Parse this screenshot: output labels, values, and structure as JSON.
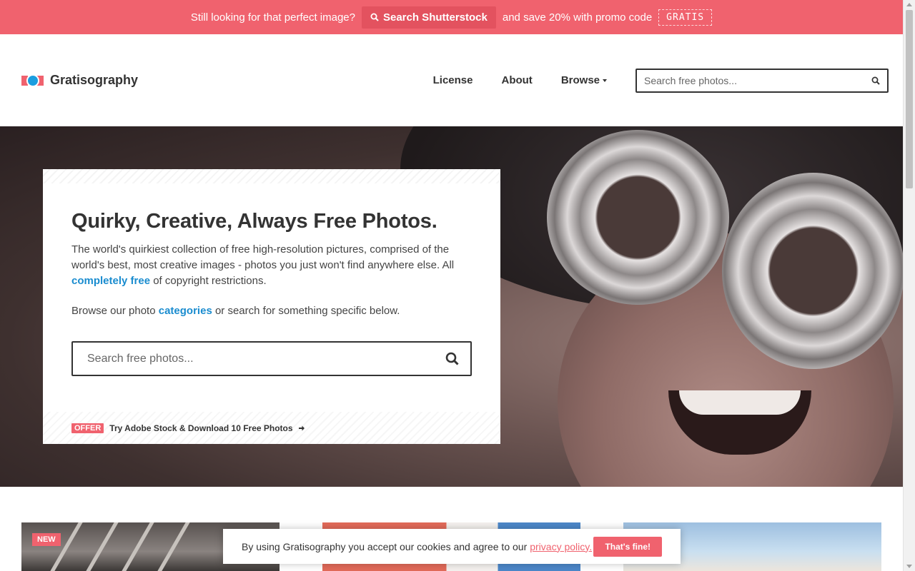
{
  "promo": {
    "lead": "Still looking for that perfect image?",
    "button": "Search Shutterstock",
    "tail": "and save 20% with promo code",
    "code": "GRATIS"
  },
  "header": {
    "logo": "Gratisography",
    "nav": [
      {
        "label": "License"
      },
      {
        "label": "About"
      },
      {
        "label": "Browse"
      }
    ],
    "search_placeholder": "Search free photos..."
  },
  "hero": {
    "title": "Quirky, Creative, Always Free Photos.",
    "description_before": "The world's quirkiest collection of free high-resolution pictures, comprised of the world's best, most creative images - photos you just won't find anywhere else. All ",
    "description_link": "completely free",
    "description_after": " of copyright restrictions.",
    "browse_before": "Browse our photo ",
    "browse_link": "categories",
    "browse_after": " or search for something specific below.",
    "search_placeholder": "Search free photos...",
    "offer_badge": "OFFER",
    "offer_text": "Try Adobe Stock & Download 10 Free Photos"
  },
  "gallery": {
    "badge": "NEW"
  },
  "cookie": {
    "text": "By using Gratisography you accept our cookies and agree to our",
    "link": "privacy policy.",
    "button": "That's fine!"
  },
  "colors": {
    "accent": "#f0626e",
    "link": "#1a8ccf",
    "logo_blue": "#1a9ee0"
  }
}
